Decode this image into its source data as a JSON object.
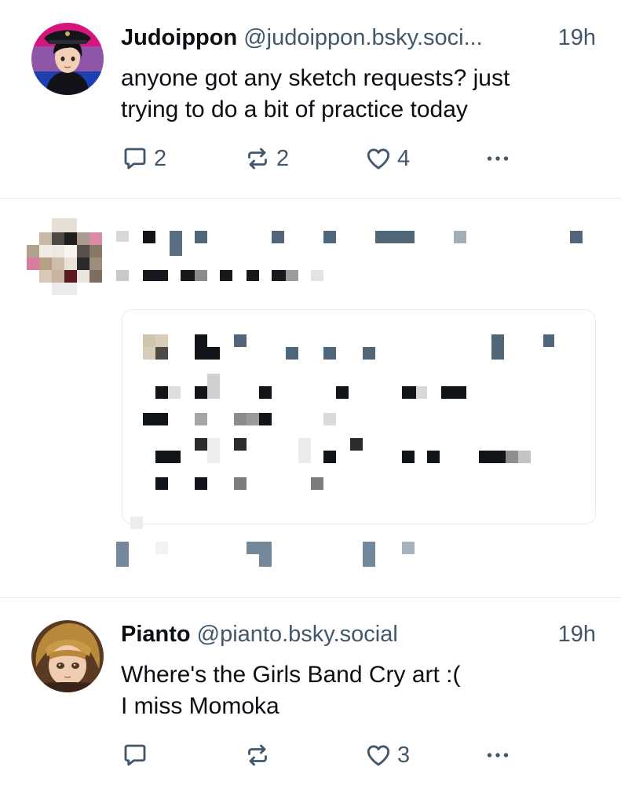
{
  "posts": [
    {
      "author": "Judoippon",
      "handle": "@judoippon.bsky.soci...",
      "time": "19h",
      "text_lines": [
        "anyone got any sketch requests? just",
        "trying to do a bit of practice today"
      ],
      "avatar_icon": "anime-character-avatar-icon",
      "actions": {
        "replies": "2",
        "reposts": "2",
        "likes": "4"
      }
    },
    {
      "obscured": true
    },
    {
      "author": "Pianto",
      "handle": "@pianto.bsky.social",
      "time": "19h",
      "text_lines": [
        "Where's the Girls Band Cry art :(",
        "I miss Momoka"
      ],
      "avatar_icon": "anime-character-avatar-icon",
      "actions": {
        "replies": "",
        "reposts": "",
        "likes": "3"
      }
    }
  ],
  "colors": {
    "text": "#0b0f14",
    "muted": "#42576c",
    "divider": "#e3e7eb"
  }
}
